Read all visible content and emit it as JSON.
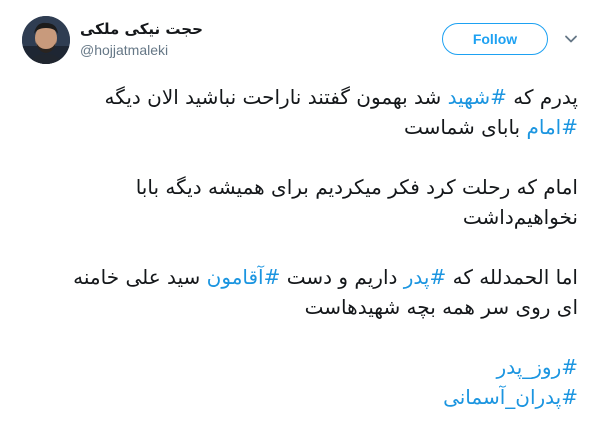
{
  "user": {
    "display_name": "حجت نیکی ملکی",
    "handle": "@hojjatmaleki",
    "avatar_icon": "user-avatar-photo"
  },
  "actions": {
    "follow_label": "Follow",
    "menu_icon": "chevron-down-icon"
  },
  "colors": {
    "hashtag": "#1b95e0",
    "follow": "#1da1f2",
    "text": "#14171a",
    "secondary": "#657786"
  },
  "tweet": {
    "p1": {
      "l1_a": "پدرم که ",
      "l1_tag": "#شهید",
      "l1_b": " شد بهمون گفتند ناراحت نباشید الان دیگه",
      "l2_tag": "#امام",
      "l2_b": " بابای شماست"
    },
    "p2": {
      "l1": "امام که رحلت کرد فکر میکردیم برای همیشه دیگه بابا",
      "l2": "نخواهیم‌داشت"
    },
    "p3": {
      "l1_a": "اما الحمدلله که ",
      "l1_tag1": "#پدر",
      "l1_b": " داریم و دست ",
      "l1_tag2": "#آقامون",
      "l1_c": " سید علی خامنه",
      "l2": "ای روی سر همه بچه شهیدهاست"
    },
    "p4": {
      "tag1": "#روز_پدر",
      "tag2": "#پدران_آسمانی"
    }
  }
}
